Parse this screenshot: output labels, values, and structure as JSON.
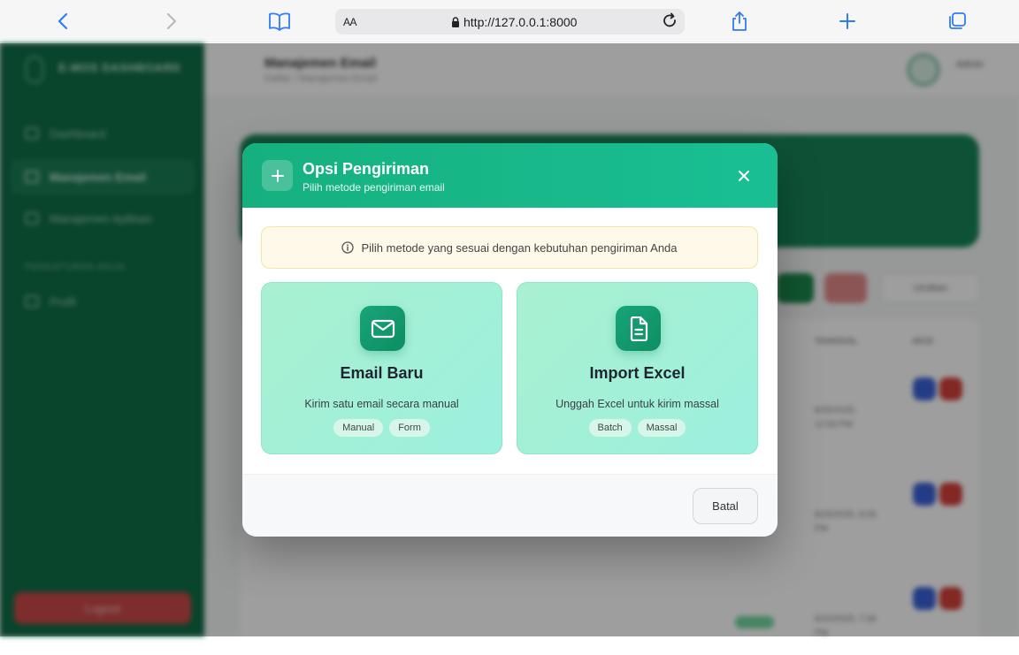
{
  "browser": {
    "text_size_label": "AA",
    "url": "http://127.0.0.1:8000"
  },
  "app": {
    "brand": "E-MOS DASHBOARD",
    "sidebar": {
      "items": [
        {
          "label": "Dashboard"
        },
        {
          "label": "Manajemen Email"
        },
        {
          "label": "Manajemen Aplikasi"
        }
      ],
      "section_label": "PENGATURAN AKUN",
      "profile_label": "Profil",
      "logout_label": "Logout"
    },
    "header": {
      "title": "Manajemen Email",
      "breadcrumb": "Daftar / Manajemen Email",
      "user_name": "Admin",
      "user_role": "admin"
    },
    "filter_label": "Urutkan",
    "table": {
      "headers": [
        "TANGGAL",
        "AKSI"
      ],
      "dates": [
        "8/25/2025, 12:59 PM",
        "8/25/2025, 8:05 PM",
        "8/24/2025, 7:48 PM"
      ]
    }
  },
  "modal": {
    "title": "Opsi Pengiriman",
    "subtitle": "Pilih metode pengiriman email",
    "info_text": "Pilih metode yang sesuai dengan kebutuhan pengiriman Anda",
    "options": [
      {
        "icon": "mail-icon",
        "title": "Email Baru",
        "description": "Kirim satu email secara manual",
        "tags": [
          "Manual",
          "Form"
        ]
      },
      {
        "icon": "file-icon",
        "title": "Import Excel",
        "description": "Unggah Excel untuk kirim massal",
        "tags": [
          "Batch",
          "Massal"
        ]
      }
    ],
    "cancel_label": "Batal"
  },
  "colors": {
    "accent": "#16b07f",
    "sidebar": "#0f6e49",
    "card_bg": "#a9f0d0"
  }
}
